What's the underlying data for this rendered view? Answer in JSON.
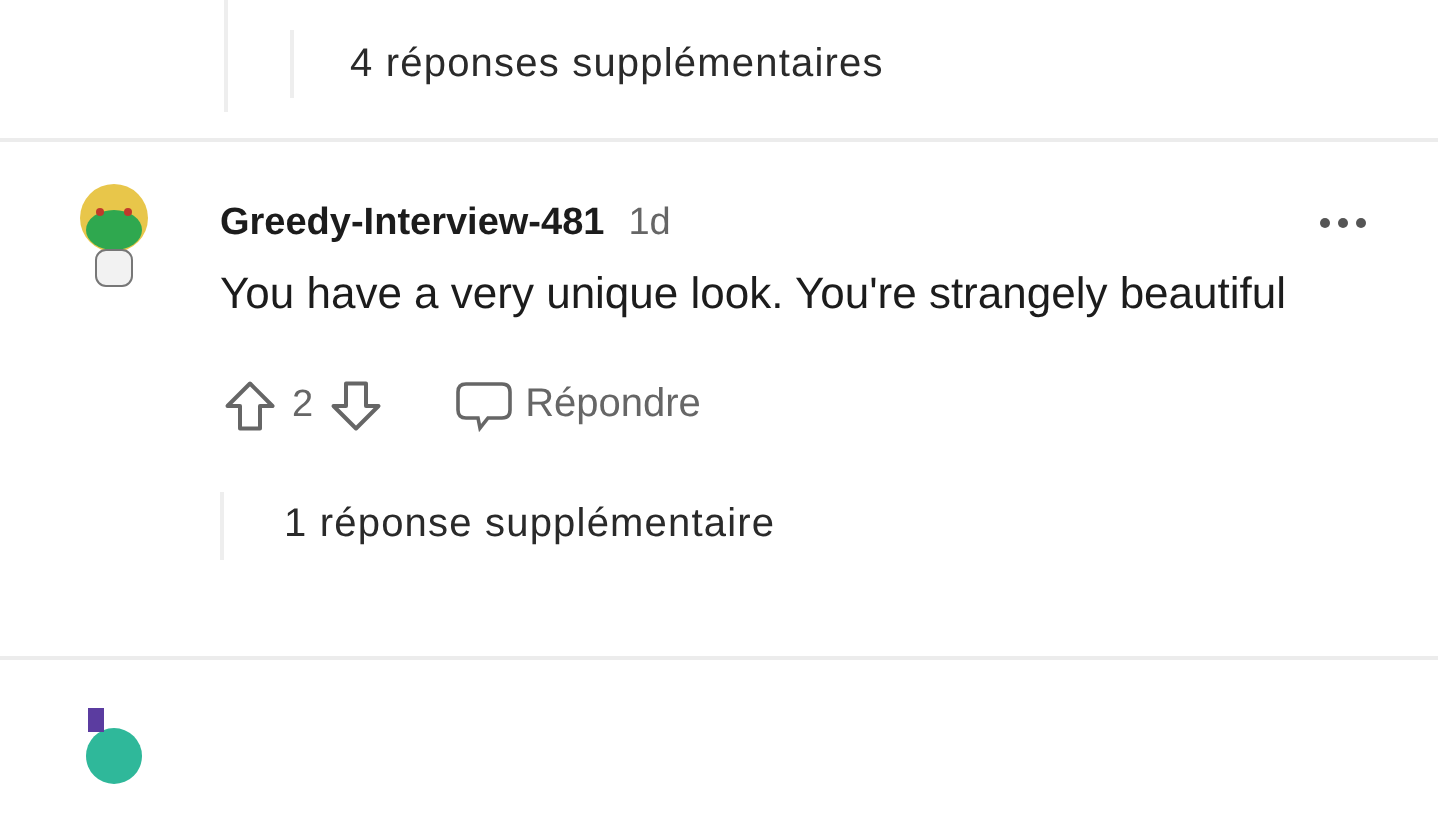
{
  "previous_thread": {
    "more_replies": "4 réponses supplémentaires"
  },
  "comment": {
    "username": "Greedy-Interview-481",
    "age": "1d",
    "body": "You have a very unique look. You're strangely beautiful",
    "votes": "2",
    "reply": "Répondre",
    "more_replies": "1 réponse supplémentaire"
  }
}
